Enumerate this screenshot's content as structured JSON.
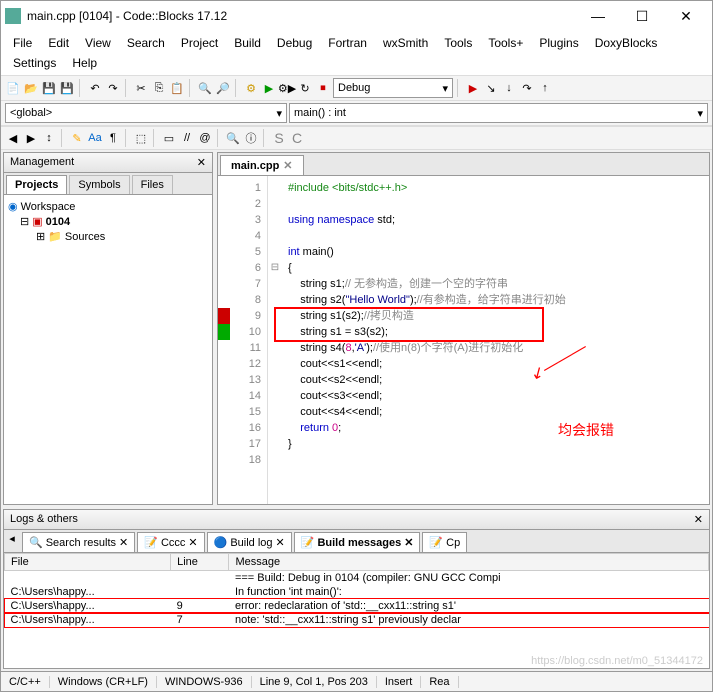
{
  "window": {
    "title": "main.cpp [0104] - Code::Blocks 17.12"
  },
  "winbtns": {
    "min": "—",
    "max": "☐",
    "close": "✕"
  },
  "menu": [
    "File",
    "Edit",
    "View",
    "Search",
    "Project",
    "Build",
    "Debug",
    "Fortran",
    "wxSmith",
    "Tools",
    "Tools+",
    "Plugins",
    "DoxyBlocks",
    "Settings",
    "Help"
  ],
  "scope": {
    "global": "<global>",
    "func": "main() : int"
  },
  "debug_combo": "Debug",
  "mgmt": {
    "title": "Management",
    "tabs": [
      "Projects",
      "Symbols",
      "Files"
    ],
    "tree": {
      "root": "Workspace",
      "project": "0104",
      "folder": "Sources"
    }
  },
  "editor": {
    "tab": "main.cpp",
    "lines": [
      {
        "n": "1",
        "html": "<span class='grn'>#include</span> <span class='grn'>&lt;bits/stdc++.h&gt;</span>"
      },
      {
        "n": "2",
        "html": ""
      },
      {
        "n": "3",
        "html": "<span class='kw'>using</span> <span class='kw'>namespace</span> std;"
      },
      {
        "n": "4",
        "html": ""
      },
      {
        "n": "5",
        "html": "<span class='kw'>int</span> main()"
      },
      {
        "n": "6",
        "html": "{"
      },
      {
        "n": "7",
        "html": "    string s1;<span class='cmt'>// 无参构造，创建一个空的字符串</span>"
      },
      {
        "n": "8",
        "html": "    string s2(<span class='str'>\"Hello World\"</span>);<span class='cmt'>//有参构造，给字符串进行初始</span>"
      },
      {
        "n": "9",
        "html": "    string s1(s2);<span class='cmt'>//拷贝构造</span>",
        "mark": "red"
      },
      {
        "n": "10",
        "html": "    string s1 = s3(s2);",
        "mark": "green"
      },
      {
        "n": "11",
        "html": "    string s4(<span class='num'>8</span>,<span class='str'>'A'</span>);<span class='cmt'>//使用n(8)个字符(A)进行初始化</span>"
      },
      {
        "n": "12",
        "html": "    cout&lt;&lt;s1&lt;&lt;endl;"
      },
      {
        "n": "13",
        "html": "    cout&lt;&lt;s2&lt;&lt;endl;"
      },
      {
        "n": "14",
        "html": "    cout&lt;&lt;s3&lt;&lt;endl;"
      },
      {
        "n": "15",
        "html": "    cout&lt;&lt;s4&lt;&lt;endl;"
      },
      {
        "n": "16",
        "html": "    <span class='kw'>return</span> <span class='num'>0</span>;"
      },
      {
        "n": "17",
        "html": "}"
      },
      {
        "n": "18",
        "html": ""
      }
    ],
    "annotation": "均会报错"
  },
  "logs": {
    "title": "Logs & others",
    "tabs": [
      "Search results",
      "Cccc",
      "Build log",
      "Build messages",
      "Cp"
    ],
    "active": 3,
    "headers": [
      "File",
      "Line",
      "Message"
    ],
    "rows": [
      {
        "f": "",
        "l": "",
        "m": "=== Build: Debug in 0104 (compiler: GNU GCC Compi"
      },
      {
        "f": "C:\\Users\\happy...",
        "l": "",
        "m": "In function 'int main()':"
      },
      {
        "f": "C:\\Users\\happy...",
        "l": "9",
        "m": "error: redeclaration of 'std::__cxx11::string s1'",
        "err": true
      },
      {
        "f": "C:\\Users\\happy...",
        "l": "7",
        "m": "note: 'std::__cxx11::string s1' previously declar",
        "err": true
      }
    ]
  },
  "status": {
    "lang": "C/C++",
    "enc": "Windows (CR+LF)",
    "cp": "WINDOWS-936",
    "pos": "Line 9, Col 1, Pos 203",
    "mode": "Insert",
    "ro": "Rea"
  },
  "watermark": "https://blog.csdn.net/m0_51344172"
}
